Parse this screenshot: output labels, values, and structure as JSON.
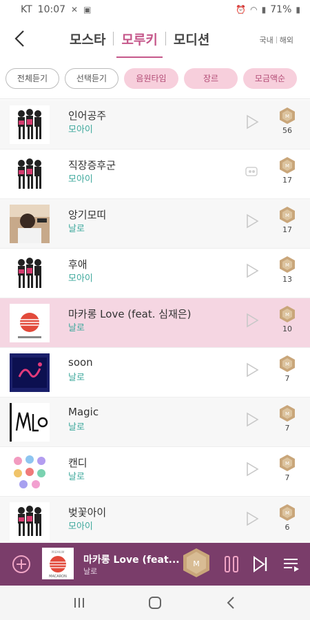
{
  "status_bar": {
    "carrier": "KT",
    "time": "10:07",
    "battery": "71%"
  },
  "header": {
    "back_icon": "back-arrow-icon",
    "tabs": [
      {
        "label": "모스타",
        "active": false
      },
      {
        "label": "모루키",
        "active": true
      },
      {
        "label": "모디션",
        "active": false
      }
    ],
    "region": {
      "domestic": "국내",
      "overseas": "해외"
    }
  },
  "filters": [
    {
      "label": "전체듣기",
      "style": "outline"
    },
    {
      "label": "선택듣기",
      "style": "outline"
    },
    {
      "label": "음원타임",
      "style": "pink"
    },
    {
      "label": "장르",
      "style": "pink"
    },
    {
      "label": "모금액순",
      "style": "pink"
    }
  ],
  "songs": [
    {
      "title": "인어공주",
      "artist": "모아이",
      "count": "56",
      "cover": "moai"
    },
    {
      "title": "직장증후군",
      "artist": "모아이",
      "count": "17",
      "cover": "moai"
    },
    {
      "title": "앙기모띠",
      "artist": "날로",
      "count": "17",
      "cover": "photo"
    },
    {
      "title": "후애",
      "artist": "모아이",
      "count": "13",
      "cover": "moai"
    },
    {
      "title": "마카롱 Love (feat. 심재은)",
      "artist": "날로",
      "count": "10",
      "cover": "macaron"
    },
    {
      "title": "soon",
      "artist": "날로",
      "count": "7",
      "cover": "dark"
    },
    {
      "title": "Magic",
      "artist": "날로",
      "count": "7",
      "cover": "magic"
    },
    {
      "title": "캔디",
      "artist": "날로",
      "count": "7",
      "cover": "candy"
    },
    {
      "title": "벚꽃아이",
      "artist": "모아이",
      "count": "6",
      "cover": "moai"
    }
  ],
  "player": {
    "title": "마카롱 Love (feat...",
    "artist": "날로",
    "cover_text_top": "PREMIUM",
    "cover_text_bottom": "MACARON"
  },
  "colors": {
    "accent": "#c5578a",
    "artist": "#3da89c",
    "player_bg": "#7a3d6a",
    "chip_pink": "#f7cfdc",
    "highlight": "#f5d6e2"
  }
}
